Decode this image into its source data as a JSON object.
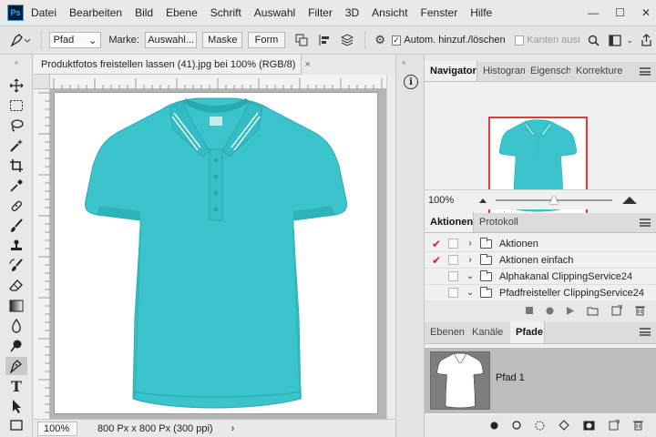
{
  "app": {
    "logo": "Ps"
  },
  "menu": [
    "Datei",
    "Bearbeiten",
    "Bild",
    "Ebene",
    "Schrift",
    "Auswahl",
    "Filter",
    "3D",
    "Ansicht",
    "Fenster",
    "Hilfe"
  ],
  "window_controls": {
    "minimize": "—",
    "maximize": "☐",
    "close": "✕"
  },
  "options": {
    "mode_value": "Pfad",
    "marke_label": "Marke:",
    "btn_selection": "Auswahl...",
    "btn_mask": "Maske",
    "btn_shape": "Form",
    "auto_add_label": "Autom. hinzuf./löschen",
    "auto_add_checked": true,
    "align_edges_label": "Kanten ausric",
    "align_edges_checked": false
  },
  "document": {
    "tab_title": "Produktfotos freistellen lassen (41).jpg bei 100% (RGB/8)",
    "tab_close": "×",
    "zoom": "100%",
    "doc_info": "800 Px x 800 Px (300 ppi)",
    "status_arrow": "›"
  },
  "navigator": {
    "tabs": [
      "Navigator",
      "Histogram",
      "Eigenschaf",
      "Korrekture"
    ],
    "active_tab": 0,
    "zoom": "100%",
    "zoom_level": 0.5
  },
  "actions": {
    "tabs": [
      "Aktionen",
      "Protokoll"
    ],
    "active_tab": 0,
    "items": [
      {
        "label": "Aktionen",
        "checked": true,
        "chevron": "›"
      },
      {
        "label": "Aktionen einfach",
        "checked": true,
        "chevron": "›"
      },
      {
        "label": "Alphakanal ClippingService24",
        "checked": false,
        "chevron": "⌄"
      },
      {
        "label": "Pfadfreisteller ClippingService24",
        "checked": false,
        "chevron": "⌄"
      }
    ],
    "bottom_icons": [
      "stop-icon",
      "record-icon",
      "play-icon",
      "new-set-icon",
      "new-action-icon",
      "delete-icon"
    ]
  },
  "paths": {
    "tabs": [
      "Ebenen",
      "Kanäle",
      "Pfade"
    ],
    "active_tab": 2,
    "items": [
      {
        "label": "Pfad 1"
      }
    ],
    "bottom_icons": [
      "fill-path-icon",
      "stroke-path-icon",
      "load-selection-icon",
      "make-path-icon",
      "add-mask-icon",
      "new-path-icon",
      "delete-icon"
    ]
  },
  "colors": {
    "shirt": "#3cc4cc",
    "shirt_shade": "#2aa9b1",
    "accent_red": "#e13a3a",
    "check": "#c8232c"
  },
  "tools": [
    "move-tool",
    "marquee-tool",
    "lasso-tool",
    "magic-wand-tool",
    "crop-tool",
    "eyedropper-tool",
    "healing-tool",
    "brush-tool",
    "stamp-tool",
    "history-brush-tool",
    "eraser-tool",
    "gradient-tool",
    "blur-tool",
    "dodge-tool",
    "pen-tool",
    "type-tool",
    "path-select-tool"
  ]
}
